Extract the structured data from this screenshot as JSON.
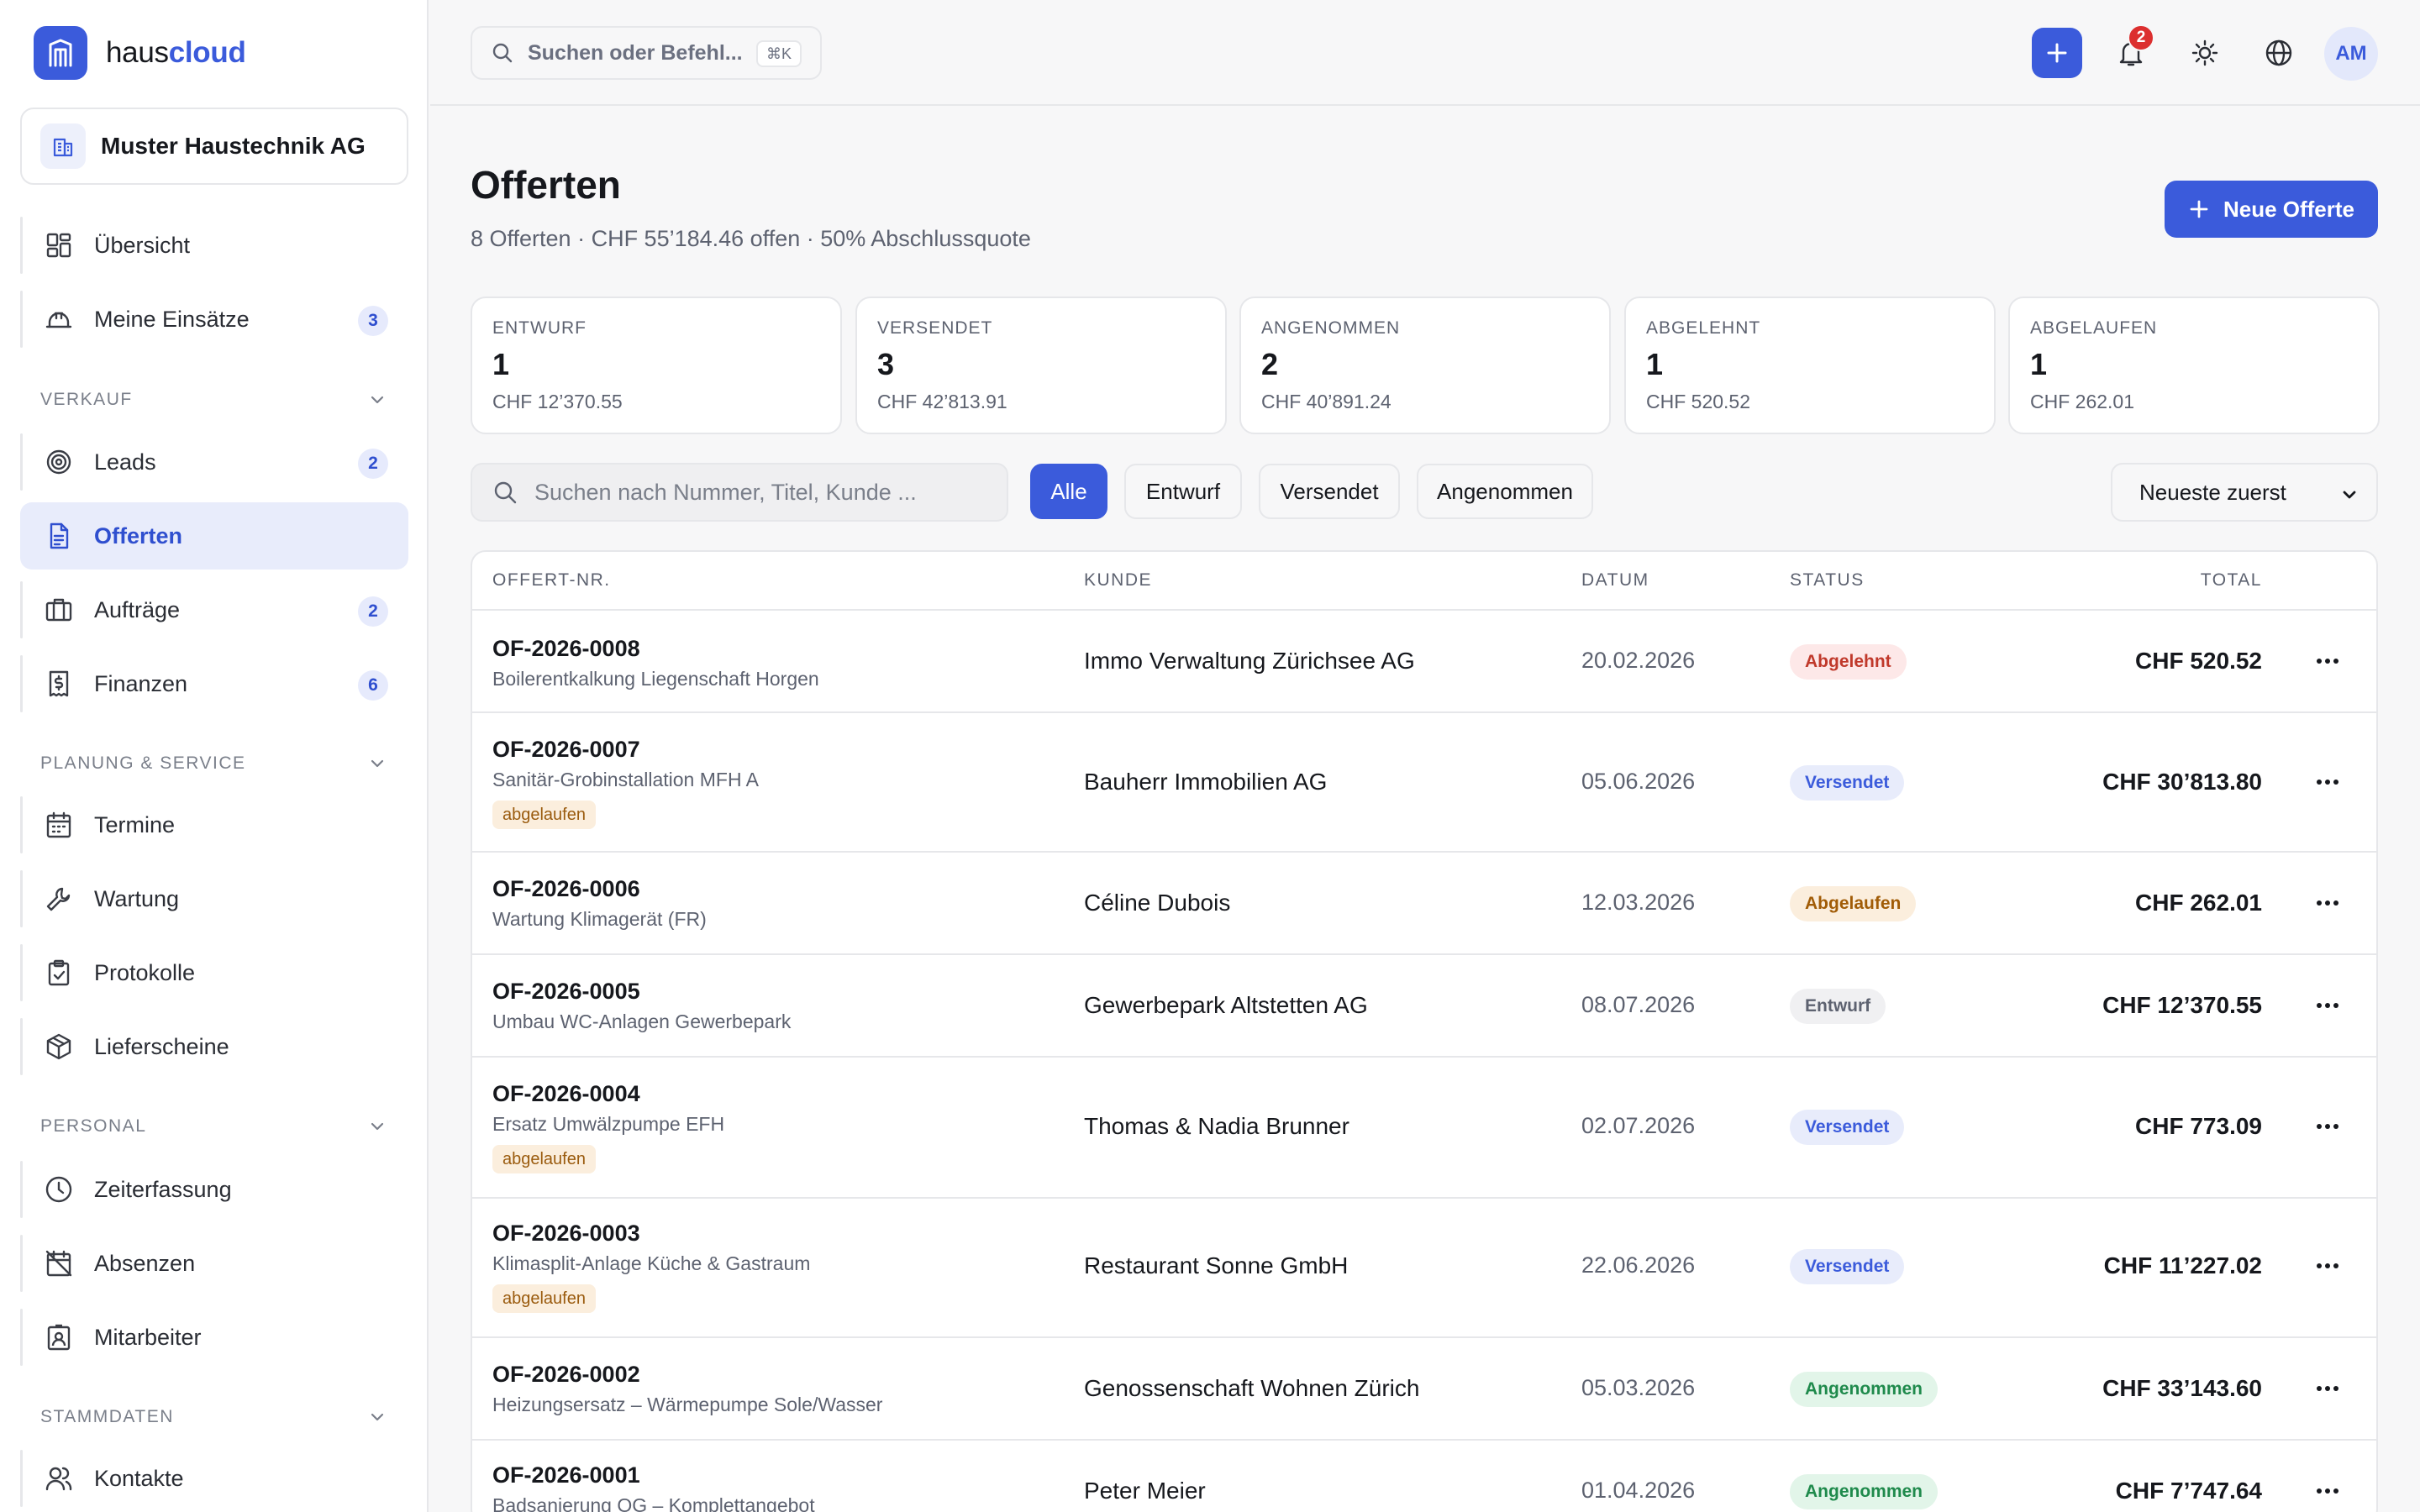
{
  "brand": {
    "name_a": "haus",
    "name_b": "cloud"
  },
  "org": {
    "name": "Muster Haustechnik AG"
  },
  "nav": {
    "overview": "Übersicht",
    "my_jobs": "Meine Einsätze",
    "my_jobs_badge": "3",
    "sec_sales": "VERKAUF",
    "leads": "Leads",
    "leads_badge": "2",
    "offers": "Offerten",
    "orders": "Aufträge",
    "orders_badge": "2",
    "finance": "Finanzen",
    "finance_badge": "6",
    "sec_planning": "PLANUNG & SERVICE",
    "appointments": "Termine",
    "maintenance": "Wartung",
    "protocols": "Protokolle",
    "delivery_notes": "Lieferscheine",
    "sec_staff": "PERSONAL",
    "time_tracking": "Zeiterfassung",
    "absences": "Absenzen",
    "employees": "Mitarbeiter",
    "sec_master": "STAMMDATEN",
    "contacts": "Kontakte"
  },
  "topbar": {
    "search_placeholder": "Suchen oder Befehl...",
    "shortcut": "⌘K",
    "notifications_count": "2",
    "avatar_initials": "AM"
  },
  "page": {
    "title": "Offerten",
    "subtitle": "8 Offerten · CHF 55’184.46 offen · 50% Abschlussquote",
    "new_button": "Neue Offerte"
  },
  "stats": [
    {
      "label": "ENTWURF",
      "count": "1",
      "amount": "CHF 12’370.55"
    },
    {
      "label": "VERSENDET",
      "count": "3",
      "amount": "CHF 42’813.91"
    },
    {
      "label": "ANGENOMMEN",
      "count": "2",
      "amount": "CHF 40’891.24"
    },
    {
      "label": "ABGELEHNT",
      "count": "1",
      "amount": "CHF 520.52"
    },
    {
      "label": "ABGELAUFEN",
      "count": "1",
      "amount": "CHF 262.01"
    }
  ],
  "filters": {
    "search_placeholder": "Suchen nach Nummer, Titel, Kunde ...",
    "chips": [
      "Alle",
      "Entwurf",
      "Versendet",
      "Angenommen"
    ],
    "sort": "Neueste zuerst"
  },
  "table": {
    "headers": {
      "number": "OFFERT-NR.",
      "customer": "KUNDE",
      "date": "DATUM",
      "status": "STATUS",
      "total": "TOTAL"
    },
    "expired_tag": "abgelaufen",
    "rows": [
      {
        "number": "OF-2026-0008",
        "title": "Boilerentkalkung Liegenschaft Horgen",
        "customer": "Immo Verwaltung Zürichsee AG",
        "date": "20.02.2026",
        "status": "Abgelehnt",
        "total": "CHF 520.52"
      },
      {
        "number": "OF-2026-0007",
        "title": "Sanitär-Grobinstallation MFH A",
        "customer": "Bauherr Immobilien AG",
        "date": "05.06.2026",
        "status": "Versendet",
        "total": "CHF 30’813.80"
      },
      {
        "number": "OF-2026-0006",
        "title": "Wartung Klimagerät (FR)",
        "customer": "Céline Dubois",
        "date": "12.03.2026",
        "status": "Abgelaufen",
        "total": "CHF 262.01"
      },
      {
        "number": "OF-2026-0005",
        "title": "Umbau WC-Anlagen Gewerbepark",
        "customer": "Gewerbepark Altstetten AG",
        "date": "08.07.2026",
        "status": "Entwurf",
        "total": "CHF 12’370.55"
      },
      {
        "number": "OF-2026-0004",
        "title": "Ersatz Umwälzpumpe EFH",
        "customer": "Thomas & Nadia Brunner",
        "date": "02.07.2026",
        "status": "Versendet",
        "total": "CHF 773.09"
      },
      {
        "number": "OF-2026-0003",
        "title": "Klimasplit-Anlage Küche & Gastraum",
        "customer": "Restaurant Sonne GmbH",
        "date": "22.06.2026",
        "status": "Versendet",
        "total": "CHF 11’227.02"
      },
      {
        "number": "OF-2026-0002",
        "title": "Heizungsersatz – Wärmepumpe Sole/Wasser",
        "customer": "Genossenschaft Wohnen Zürich",
        "date": "05.03.2026",
        "status": "Angenommen",
        "total": "CHF 33’143.60"
      },
      {
        "number": "OF-2026-0001",
        "title": "Badsanierung OG – Komplettangebot",
        "customer": "Peter Meier",
        "date": "01.04.2026",
        "status": "Angenommen",
        "total": "CHF 7’747.64"
      }
    ]
  },
  "colors": {
    "accent": "#3b5bdb",
    "danger": "#dc2f2f",
    "success": "#1f8a4c",
    "warning": "#a15c07"
  }
}
